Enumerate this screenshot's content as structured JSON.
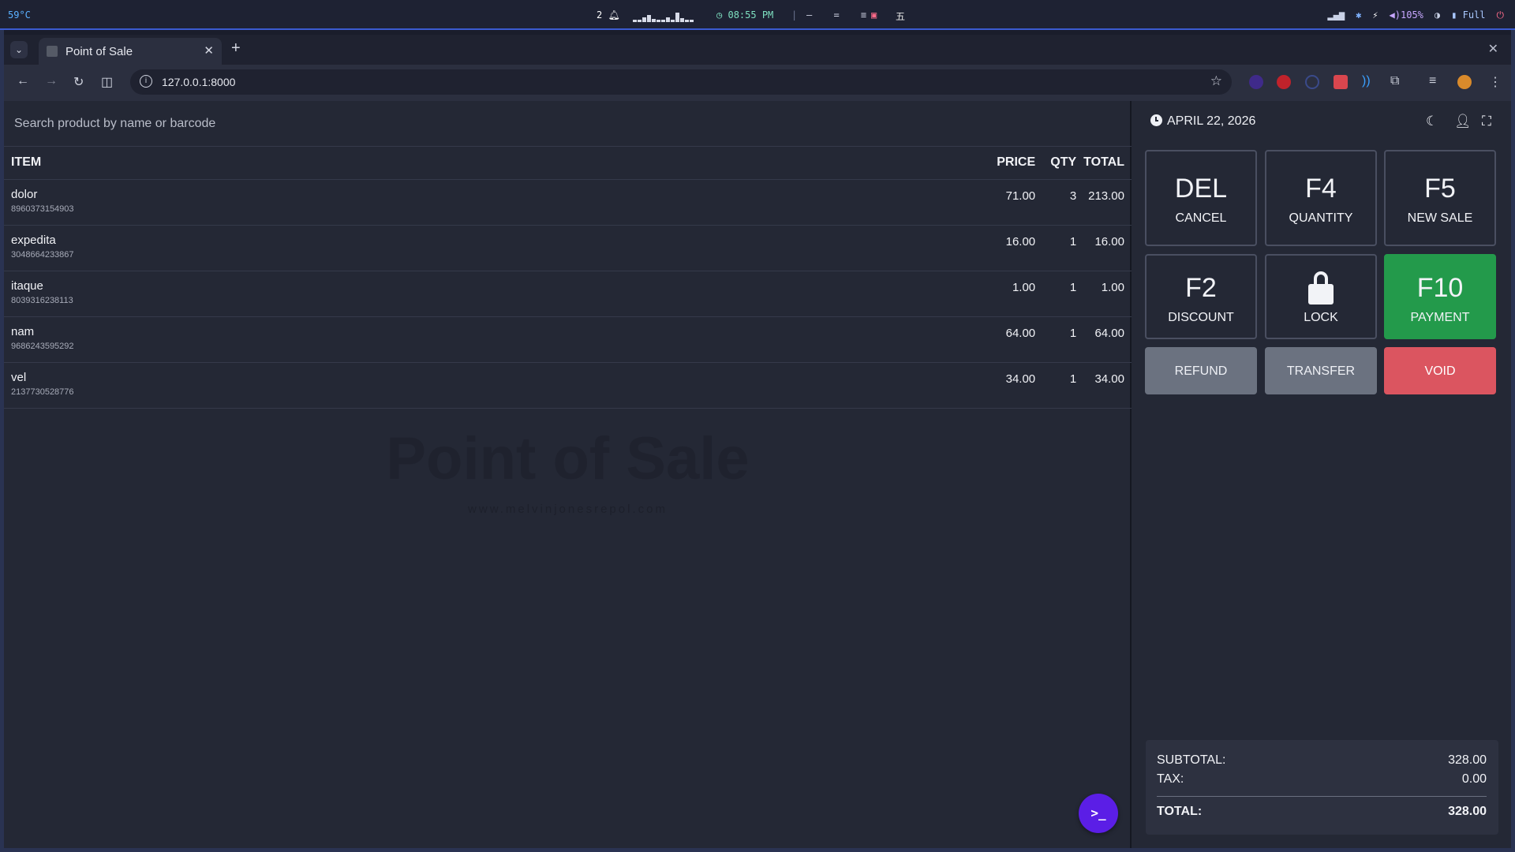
{
  "system_bar": {
    "temperature": "59°C",
    "workspace": "2",
    "clock": "08:55 PM",
    "layout_glyphs": "— = ≡",
    "kanji": "五",
    "volume": "105%",
    "battery": "Full"
  },
  "browser": {
    "tab_title": "Point of Sale",
    "url": "127.0.0.1:8000"
  },
  "search": {
    "placeholder": "Search product by name or barcode"
  },
  "table": {
    "headers": {
      "item": "ITEM",
      "price": "PRICE",
      "qty": "QTY",
      "total": "TOTAL"
    },
    "rows": [
      {
        "name": "dolor",
        "code": "8960373154903",
        "price": "71.00",
        "qty": "3",
        "total": "213.00"
      },
      {
        "name": "expedita",
        "code": "3048664233867",
        "price": "16.00",
        "qty": "1",
        "total": "16.00"
      },
      {
        "name": "itaque",
        "code": "8039316238113",
        "price": "1.00",
        "qty": "1",
        "total": "1.00"
      },
      {
        "name": "nam",
        "code": "9686243595292",
        "price": "64.00",
        "qty": "1",
        "total": "64.00"
      },
      {
        "name": "vel",
        "code": "2137730528776",
        "price": "34.00",
        "qty": "1",
        "total": "34.00"
      }
    ]
  },
  "watermark": {
    "title": "Point of Sale",
    "subtitle": "www.melvinjonesrepol.com"
  },
  "fab": {
    "glyph": ">_"
  },
  "panel": {
    "date": "APRIL 22, 2026",
    "keys": {
      "cancel": {
        "code": "DEL",
        "label": "CANCEL"
      },
      "quantity": {
        "code": "F4",
        "label": "QUANTITY"
      },
      "new_sale": {
        "code": "F5",
        "label": "NEW SALE"
      },
      "discount": {
        "code": "F2",
        "label": "DISCOUNT"
      },
      "lock": {
        "label": "LOCK"
      },
      "payment": {
        "code": "F10",
        "label": "PAYMENT"
      },
      "refund": {
        "label": "REFUND"
      },
      "transfer": {
        "label": "TRANSFER"
      },
      "void": {
        "label": "VOID"
      }
    },
    "totals": {
      "subtotal_label": "SUBTOTAL:",
      "subtotal": "328.00",
      "tax_label": "TAX:",
      "tax": "0.00",
      "total_label": "TOTAL:",
      "total": "328.00"
    }
  },
  "colors": {
    "accent_green": "#239a4b",
    "void_red": "#db5560",
    "fab_purple": "#5b1ee6",
    "flat_gray": "#6b7280"
  }
}
